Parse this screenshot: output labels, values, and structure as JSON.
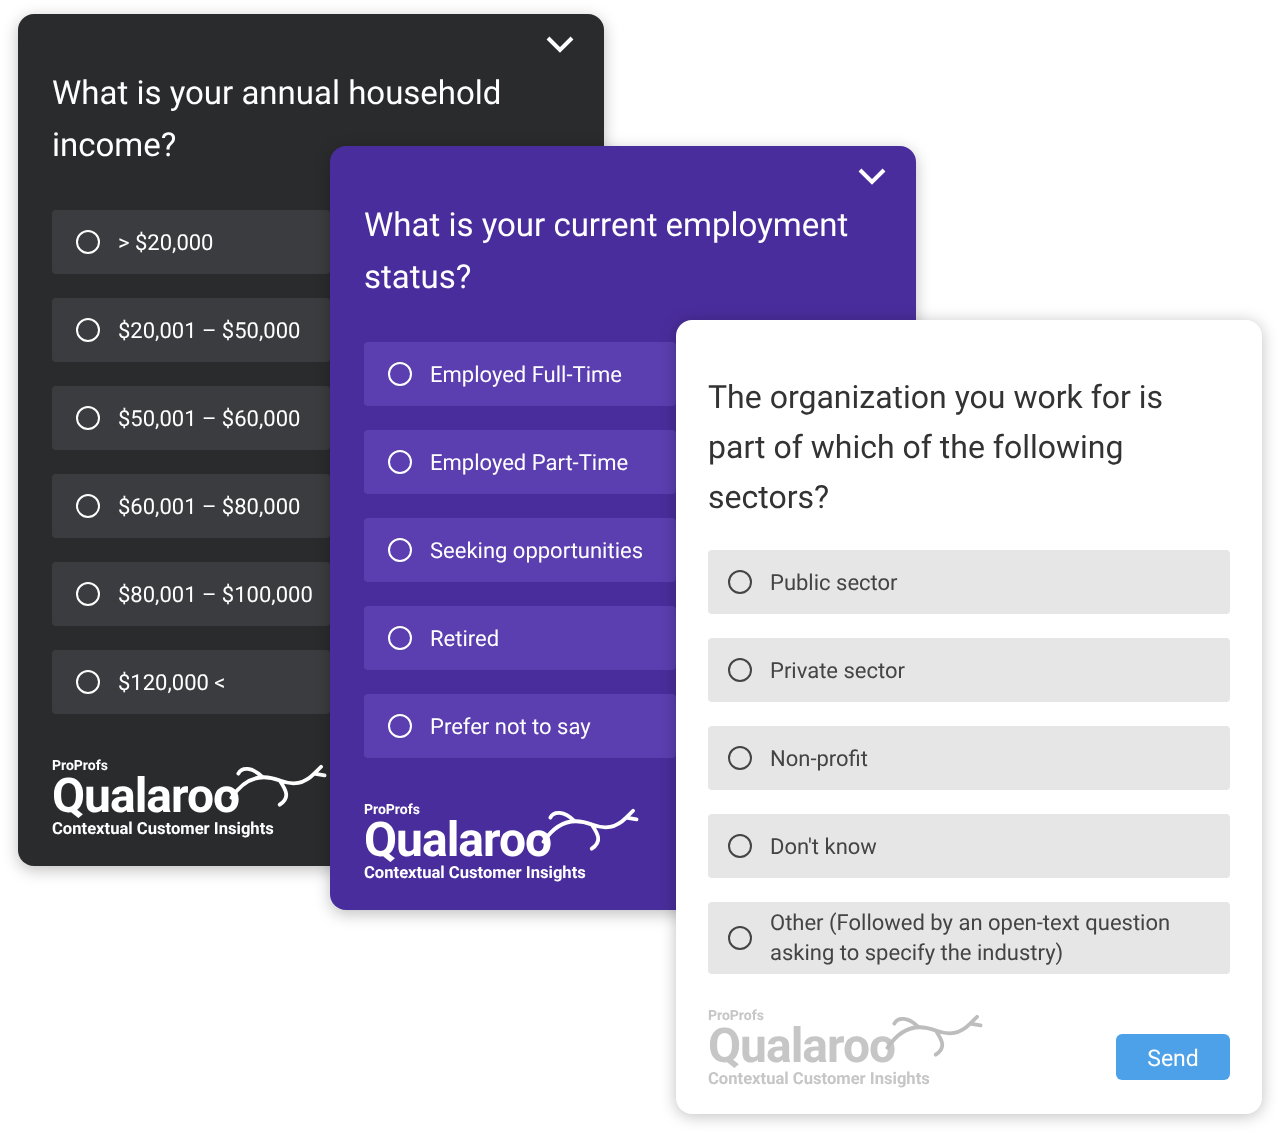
{
  "surveys": [
    {
      "kind": "dark",
      "question": "What is your annual household income?",
      "options": [
        {
          "label": "> $20,000",
          "selected": false
        },
        {
          "label": "$20,001 – $50,000",
          "selected": false
        },
        {
          "label": "$50,001 – $60,000",
          "selected": false
        },
        {
          "label": "$60,001 – $80,000",
          "selected": false
        },
        {
          "label": "$80,001 – $100,000",
          "selected": false
        },
        {
          "label": "$120,000 <",
          "selected": false
        }
      ],
      "logo": {
        "brand": "ProProfs",
        "name": "Qualaroo",
        "tagline": "Contextual Customer Insights"
      }
    },
    {
      "kind": "purple",
      "question": "What is your current employment status?",
      "options": [
        {
          "label": "Employed Full-Time",
          "selected": false
        },
        {
          "label": "Employed Part-Time",
          "selected": false
        },
        {
          "label": "Seeking opportunities",
          "selected": false
        },
        {
          "label": "Retired",
          "selected": false
        },
        {
          "label": "Prefer not to say",
          "selected": false
        }
      ],
      "logo": {
        "brand": "ProProfs",
        "name": "Qualaroo",
        "tagline": "Contextual Customer Insights"
      }
    },
    {
      "kind": "light",
      "question": "The organization you work for is part of which of the following sectors?",
      "options": [
        {
          "label": "Public sector",
          "selected": false
        },
        {
          "label": "Private sector",
          "selected": false
        },
        {
          "label": "Non-profit",
          "selected": false
        },
        {
          "label": "Don't know",
          "selected": false
        },
        {
          "label": "Other (Followed by an open-text question asking to specify the industry)",
          "selected": false
        }
      ],
      "logo": {
        "brand": "ProProfs",
        "name": "Qualaroo",
        "tagline": "Contextual Customer Insights"
      },
      "button": "Send"
    }
  ]
}
